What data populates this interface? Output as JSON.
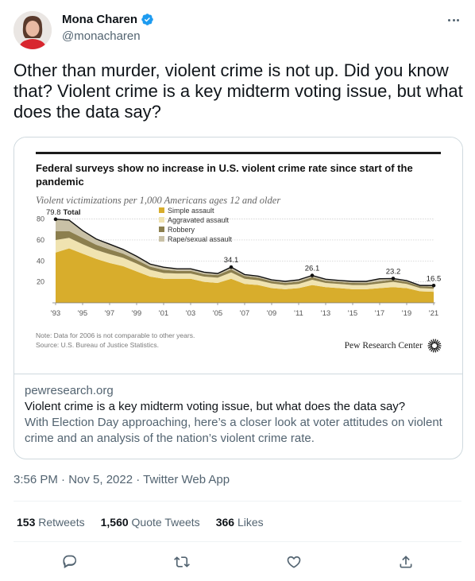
{
  "author": {
    "name": "Mona Charen",
    "handle": "@monacharen"
  },
  "tweet": {
    "text": "Other than murder, violent crime is not up. Did you know that? Violent crime is a key midterm voting issue, but what does the data say?"
  },
  "card": {
    "domain": "pewresearch.org",
    "title": "Violent crime is a key midterm voting issue, but what does the data say?",
    "description": "With Election Day approaching, here’s a closer look at voter attitudes on violent crime and an analysis of the nation’s violent crime rate.",
    "image": {
      "title": "Federal surveys show no increase in U.S. violent crime rate since start of the pandemic",
      "subtitle": "Violent victimizations per 1,000 Americans ages 12 and older",
      "note_line1": "Note: Data for 2006 is not comparable to other years.",
      "note_line2": "Source: U.S. Bureau of Justice Statistics.",
      "brand": "Pew Research Center"
    }
  },
  "chart_data": {
    "type": "area",
    "stacked": true,
    "x": [
      1993,
      1994,
      1995,
      1996,
      1997,
      1998,
      1999,
      2000,
      2001,
      2002,
      2003,
      2004,
      2005,
      2006,
      2007,
      2008,
      2009,
      2010,
      2011,
      2012,
      2013,
      2014,
      2015,
      2016,
      2017,
      2018,
      2019,
      2020,
      2021
    ],
    "series": [
      {
        "name": "Simple assault",
        "color": "#d8ad2c",
        "values": [
          48,
          52,
          47,
          42,
          38,
          35,
          30,
          25,
          23,
          23,
          23,
          20,
          19,
          23,
          18,
          17,
          14,
          13,
          14,
          17,
          15,
          14,
          13,
          13,
          14,
          15,
          14,
          11,
          10.5
        ]
      },
      {
        "name": "Aggravated assault",
        "color": "#f0e3b0",
        "values": [
          12,
          10,
          9,
          8.5,
          8.5,
          8,
          7.5,
          6.5,
          5.5,
          5,
          5,
          5,
          5,
          6,
          5,
          4.5,
          4.5,
          4,
          4,
          5,
          4,
          4,
          4,
          4,
          4.5,
          5,
          4,
          3,
          3
        ]
      },
      {
        "name": "Robbery",
        "color": "#8c7f4e",
        "values": [
          8.5,
          6.5,
          6,
          5,
          4.5,
          4,
          3.5,
          3,
          3,
          2.5,
          2.5,
          2.3,
          2.5,
          3,
          2.5,
          2.5,
          2.2,
          2,
          2.2,
          2.5,
          2,
          1.9,
          2,
          1.9,
          2,
          2,
          2,
          1.8,
          1.8
        ]
      },
      {
        "name": "Rape/sexual assault",
        "color": "#c9c1a6",
        "values": [
          11.3,
          10.5,
          7,
          5.5,
          5,
          4,
          3.5,
          2.5,
          2.5,
          2,
          2,
          2,
          1.5,
          2.1,
          1.5,
          1.5,
          1.3,
          1.5,
          1.8,
          1.6,
          1.5,
          1.5,
          1.5,
          1.6,
          2.5,
          1.2,
          1.2,
          0.8,
          1.2
        ]
      }
    ],
    "total_labels": [
      {
        "year": 1993,
        "value": "79.8",
        "suffix": "Total"
      },
      {
        "year": 2006,
        "value": "34.1"
      },
      {
        "year": 2012,
        "value": "26.1"
      },
      {
        "year": 2018,
        "value": "23.2"
      },
      {
        "year": 2021,
        "value": "16.5"
      }
    ],
    "yticks": [
      20,
      40,
      60,
      80
    ],
    "xticks": [
      "'93",
      "'95",
      "'97",
      "'99",
      "'01",
      "'03",
      "'05",
      "'07",
      "'09",
      "'11",
      "'13",
      "'15",
      "'17",
      "'19",
      "'21"
    ],
    "ylim": [
      0,
      85
    ],
    "legend_position": "top-center"
  },
  "meta": {
    "timestamp": "3:56 PM · Nov 5, 2022 · Twitter Web App"
  },
  "stats": {
    "retweets_count": "153",
    "retweets_label": "Retweets",
    "quotes_count": "1,560",
    "quotes_label": "Quote Tweets",
    "likes_count": "366",
    "likes_label": "Likes"
  },
  "colors": {
    "accent": "#1d9bf0",
    "text": "#0f1419",
    "muted": "#536471",
    "border": "#cfd9de"
  }
}
